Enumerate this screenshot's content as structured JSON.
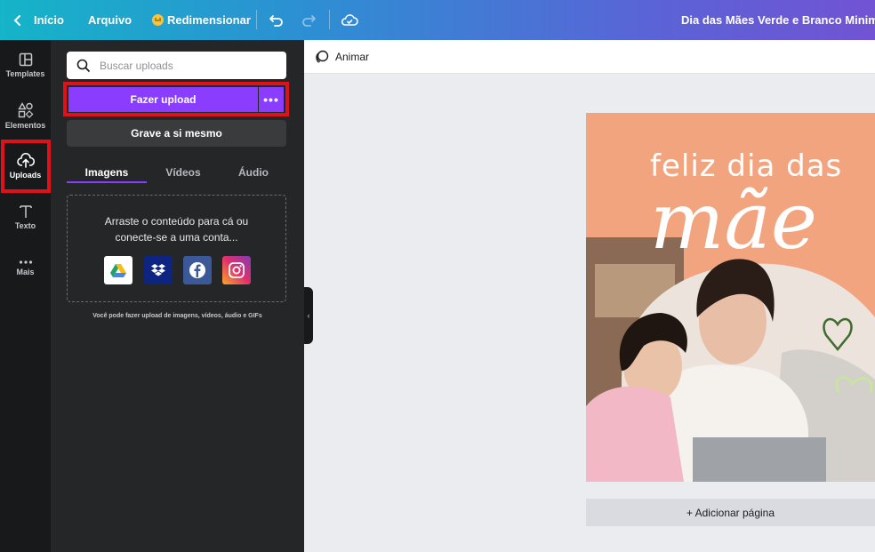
{
  "topbar": {
    "back_label": "Início",
    "file_label": "Arquivo",
    "resize_label": "Redimensionar",
    "doc_title": "Dia das Mães Verde e Branco Minimalista"
  },
  "rail": {
    "items": [
      {
        "label": "Templates",
        "icon": "templates-icon"
      },
      {
        "label": "Elementos",
        "icon": "elements-icon"
      },
      {
        "label": "Uploads",
        "icon": "upload-cloud-icon",
        "active": true
      },
      {
        "label": "Texto",
        "icon": "text-icon"
      },
      {
        "label": "Mais",
        "icon": "more-icon"
      }
    ]
  },
  "panel": {
    "search_placeholder": "Buscar uploads",
    "upload_button": "Fazer upload",
    "more_button": "•••",
    "record_button": "Grave a si mesmo",
    "tabs": [
      {
        "label": "Imagens",
        "active": true
      },
      {
        "label": "Vídeos"
      },
      {
        "label": "Áudio"
      }
    ],
    "dropzone_text_line1": "Arraste o conteúdo para cá ou",
    "dropzone_text_line2": "conecte-se a uma conta...",
    "services": [
      "google-drive-icon",
      "dropbox-icon",
      "facebook-icon",
      "instagram-icon"
    ],
    "hint": "Você pode fazer upload de imagens, vídeos, áudio e GIFs"
  },
  "canvas": {
    "animate_label": "Animar",
    "design_heading": "feliz dia das",
    "design_script": "mãe",
    "add_page_label": "+ Adicionar página"
  },
  "colors": {
    "accent": "#8b3dff",
    "highlight": "#e11119",
    "design_bg": "#f2a47f"
  }
}
